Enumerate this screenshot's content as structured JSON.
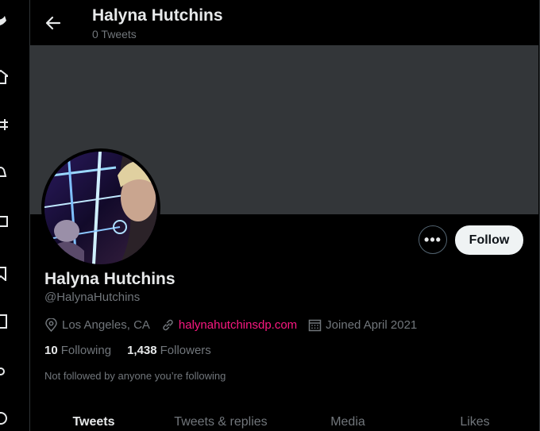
{
  "header": {
    "title": "Halyna Hutchins",
    "subtitle": "0 Tweets"
  },
  "profile": {
    "name": "Halyna Hutchins",
    "handle": "@HalynaHutchins",
    "location": "Los Angeles, CA",
    "website": "halynahutchinsdp.com",
    "joined": "Joined April 2021",
    "following_count": "10",
    "following_label": "Following",
    "followers_count": "1,438",
    "followers_label": "Followers",
    "followed_note": "Not followed by anyone you’re following"
  },
  "actions": {
    "more_label": "•••",
    "follow_label": "Follow"
  },
  "tabs": [
    {
      "label": "Tweets",
      "active": true
    },
    {
      "label": "Tweets & replies",
      "active": false
    },
    {
      "label": "Media",
      "active": false
    },
    {
      "label": "Likes",
      "active": false
    }
  ],
  "colors": {
    "background": "#000000",
    "banner": "#333639",
    "link": "#f91880",
    "secondary_text": "#71767b"
  },
  "icons": [
    "back-arrow-icon",
    "location-pin-icon",
    "link-icon",
    "calendar-icon"
  ]
}
